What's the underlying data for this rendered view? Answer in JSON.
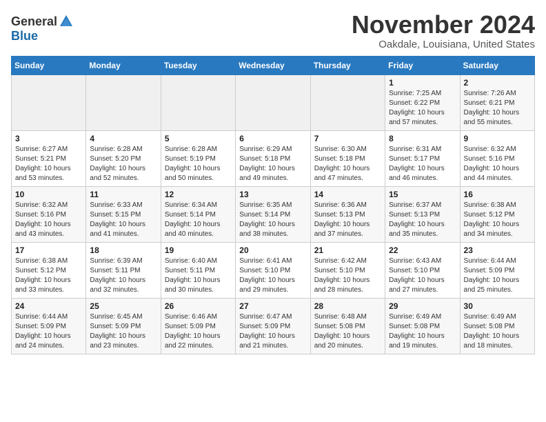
{
  "logo": {
    "general": "General",
    "blue": "Blue"
  },
  "title": "November 2024",
  "location": "Oakdale, Louisiana, United States",
  "days_of_week": [
    "Sunday",
    "Monday",
    "Tuesday",
    "Wednesday",
    "Thursday",
    "Friday",
    "Saturday"
  ],
  "weeks": [
    [
      {
        "day": "",
        "sunrise": "",
        "sunset": "",
        "daylight": ""
      },
      {
        "day": "",
        "sunrise": "",
        "sunset": "",
        "daylight": ""
      },
      {
        "day": "",
        "sunrise": "",
        "sunset": "",
        "daylight": ""
      },
      {
        "day": "",
        "sunrise": "",
        "sunset": "",
        "daylight": ""
      },
      {
        "day": "",
        "sunrise": "",
        "sunset": "",
        "daylight": ""
      },
      {
        "day": "1",
        "sunrise": "Sunrise: 7:25 AM",
        "sunset": "Sunset: 6:22 PM",
        "daylight": "Daylight: 10 hours and 57 minutes."
      },
      {
        "day": "2",
        "sunrise": "Sunrise: 7:26 AM",
        "sunset": "Sunset: 6:21 PM",
        "daylight": "Daylight: 10 hours and 55 minutes."
      }
    ],
    [
      {
        "day": "3",
        "sunrise": "Sunrise: 6:27 AM",
        "sunset": "Sunset: 5:21 PM",
        "daylight": "Daylight: 10 hours and 53 minutes."
      },
      {
        "day": "4",
        "sunrise": "Sunrise: 6:28 AM",
        "sunset": "Sunset: 5:20 PM",
        "daylight": "Daylight: 10 hours and 52 minutes."
      },
      {
        "day": "5",
        "sunrise": "Sunrise: 6:28 AM",
        "sunset": "Sunset: 5:19 PM",
        "daylight": "Daylight: 10 hours and 50 minutes."
      },
      {
        "day": "6",
        "sunrise": "Sunrise: 6:29 AM",
        "sunset": "Sunset: 5:18 PM",
        "daylight": "Daylight: 10 hours and 49 minutes."
      },
      {
        "day": "7",
        "sunrise": "Sunrise: 6:30 AM",
        "sunset": "Sunset: 5:18 PM",
        "daylight": "Daylight: 10 hours and 47 minutes."
      },
      {
        "day": "8",
        "sunrise": "Sunrise: 6:31 AM",
        "sunset": "Sunset: 5:17 PM",
        "daylight": "Daylight: 10 hours and 46 minutes."
      },
      {
        "day": "9",
        "sunrise": "Sunrise: 6:32 AM",
        "sunset": "Sunset: 5:16 PM",
        "daylight": "Daylight: 10 hours and 44 minutes."
      }
    ],
    [
      {
        "day": "10",
        "sunrise": "Sunrise: 6:32 AM",
        "sunset": "Sunset: 5:16 PM",
        "daylight": "Daylight: 10 hours and 43 minutes."
      },
      {
        "day": "11",
        "sunrise": "Sunrise: 6:33 AM",
        "sunset": "Sunset: 5:15 PM",
        "daylight": "Daylight: 10 hours and 41 minutes."
      },
      {
        "day": "12",
        "sunrise": "Sunrise: 6:34 AM",
        "sunset": "Sunset: 5:14 PM",
        "daylight": "Daylight: 10 hours and 40 minutes."
      },
      {
        "day": "13",
        "sunrise": "Sunrise: 6:35 AM",
        "sunset": "Sunset: 5:14 PM",
        "daylight": "Daylight: 10 hours and 38 minutes."
      },
      {
        "day": "14",
        "sunrise": "Sunrise: 6:36 AM",
        "sunset": "Sunset: 5:13 PM",
        "daylight": "Daylight: 10 hours and 37 minutes."
      },
      {
        "day": "15",
        "sunrise": "Sunrise: 6:37 AM",
        "sunset": "Sunset: 5:13 PM",
        "daylight": "Daylight: 10 hours and 35 minutes."
      },
      {
        "day": "16",
        "sunrise": "Sunrise: 6:38 AM",
        "sunset": "Sunset: 5:12 PM",
        "daylight": "Daylight: 10 hours and 34 minutes."
      }
    ],
    [
      {
        "day": "17",
        "sunrise": "Sunrise: 6:38 AM",
        "sunset": "Sunset: 5:12 PM",
        "daylight": "Daylight: 10 hours and 33 minutes."
      },
      {
        "day": "18",
        "sunrise": "Sunrise: 6:39 AM",
        "sunset": "Sunset: 5:11 PM",
        "daylight": "Daylight: 10 hours and 32 minutes."
      },
      {
        "day": "19",
        "sunrise": "Sunrise: 6:40 AM",
        "sunset": "Sunset: 5:11 PM",
        "daylight": "Daylight: 10 hours and 30 minutes."
      },
      {
        "day": "20",
        "sunrise": "Sunrise: 6:41 AM",
        "sunset": "Sunset: 5:10 PM",
        "daylight": "Daylight: 10 hours and 29 minutes."
      },
      {
        "day": "21",
        "sunrise": "Sunrise: 6:42 AM",
        "sunset": "Sunset: 5:10 PM",
        "daylight": "Daylight: 10 hours and 28 minutes."
      },
      {
        "day": "22",
        "sunrise": "Sunrise: 6:43 AM",
        "sunset": "Sunset: 5:10 PM",
        "daylight": "Daylight: 10 hours and 27 minutes."
      },
      {
        "day": "23",
        "sunrise": "Sunrise: 6:44 AM",
        "sunset": "Sunset: 5:09 PM",
        "daylight": "Daylight: 10 hours and 25 minutes."
      }
    ],
    [
      {
        "day": "24",
        "sunrise": "Sunrise: 6:44 AM",
        "sunset": "Sunset: 5:09 PM",
        "daylight": "Daylight: 10 hours and 24 minutes."
      },
      {
        "day": "25",
        "sunrise": "Sunrise: 6:45 AM",
        "sunset": "Sunset: 5:09 PM",
        "daylight": "Daylight: 10 hours and 23 minutes."
      },
      {
        "day": "26",
        "sunrise": "Sunrise: 6:46 AM",
        "sunset": "Sunset: 5:09 PM",
        "daylight": "Daylight: 10 hours and 22 minutes."
      },
      {
        "day": "27",
        "sunrise": "Sunrise: 6:47 AM",
        "sunset": "Sunset: 5:09 PM",
        "daylight": "Daylight: 10 hours and 21 minutes."
      },
      {
        "day": "28",
        "sunrise": "Sunrise: 6:48 AM",
        "sunset": "Sunset: 5:08 PM",
        "daylight": "Daylight: 10 hours and 20 minutes."
      },
      {
        "day": "29",
        "sunrise": "Sunrise: 6:49 AM",
        "sunset": "Sunset: 5:08 PM",
        "daylight": "Daylight: 10 hours and 19 minutes."
      },
      {
        "day": "30",
        "sunrise": "Sunrise: 6:49 AM",
        "sunset": "Sunset: 5:08 PM",
        "daylight": "Daylight: 10 hours and 18 minutes."
      }
    ]
  ]
}
